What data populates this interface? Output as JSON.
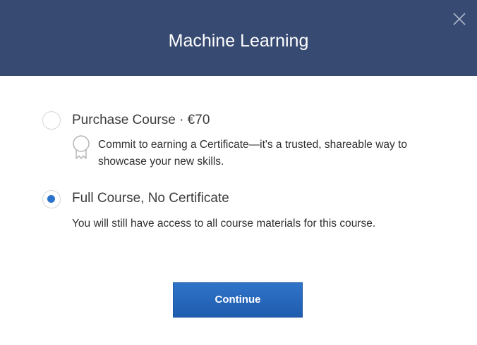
{
  "header": {
    "title": "Machine Learning",
    "close_icon": "close-icon"
  },
  "options": [
    {
      "label": "Purchase Course · €70",
      "description": "Commit to earning a Certificate—it's a trusted, shareable way to showcase your new skills.",
      "icon": "certificate-icon",
      "selected": false
    },
    {
      "label": "Full Course, No Certificate",
      "description": "You will still have access to all course materials for this course.",
      "selected": true
    }
  ],
  "footer": {
    "continue_label": "Continue"
  },
  "colors": {
    "header_bg": "#374a72",
    "accent": "#2a73cc",
    "button_bg": "#2766ba"
  }
}
